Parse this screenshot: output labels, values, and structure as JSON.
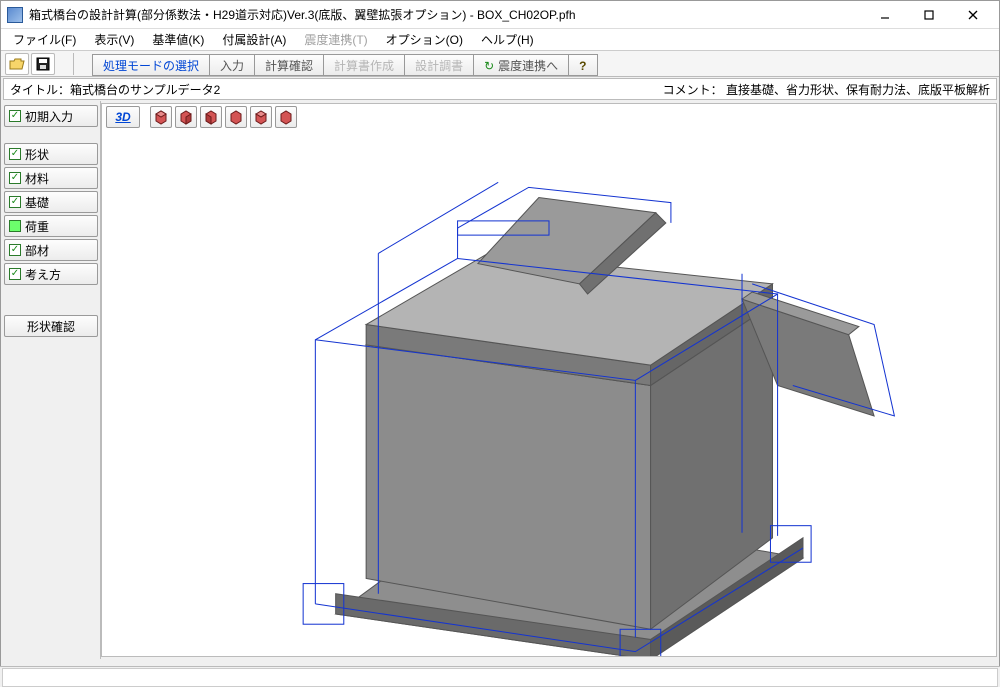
{
  "window": {
    "title": "箱式橋台の設計計算(部分係数法・H29道示対応)Ver.3(底版、翼壁拡張オプション) - BOX_CH02OP.pfh"
  },
  "menu": {
    "file": "ファイル(F)",
    "view": "表示(V)",
    "standard": "基準値(K)",
    "auxiliary": "付属設計(A)",
    "seismic": "震度連携(T)",
    "option": "オプション(O)",
    "help": "ヘルプ(H)"
  },
  "icons": {
    "open": "open-icon",
    "save": "save-icon"
  },
  "mode_tabs": {
    "mode_select": "処理モードの選択",
    "input": "入力",
    "calc_check": "計算確認",
    "calc_report": "計算書作成",
    "design_adjust": "設計調書",
    "seismic_link": "震度連携へ",
    "help": "?"
  },
  "info": {
    "title_label": "タイトル：",
    "title_value": "箱式橋台のサンプルデータ2",
    "comment_label": "コメント：",
    "comment_value": "直接基礎、省力形状、保有耐力法、底版平板解析"
  },
  "sidebar": {
    "items": [
      {
        "label": "初期入力",
        "chk": "green"
      },
      {
        "label": "形状",
        "chk": "green"
      },
      {
        "label": "材料",
        "chk": "green"
      },
      {
        "label": "基礎",
        "chk": "green"
      },
      {
        "label": "荷重",
        "chk": "lime"
      },
      {
        "label": "部材",
        "chk": "green"
      },
      {
        "label": "考え方",
        "chk": "green"
      }
    ],
    "shape_confirm": "形状確認"
  },
  "view_toolbar": {
    "btn_3d": "3D",
    "cube_count": 6
  }
}
